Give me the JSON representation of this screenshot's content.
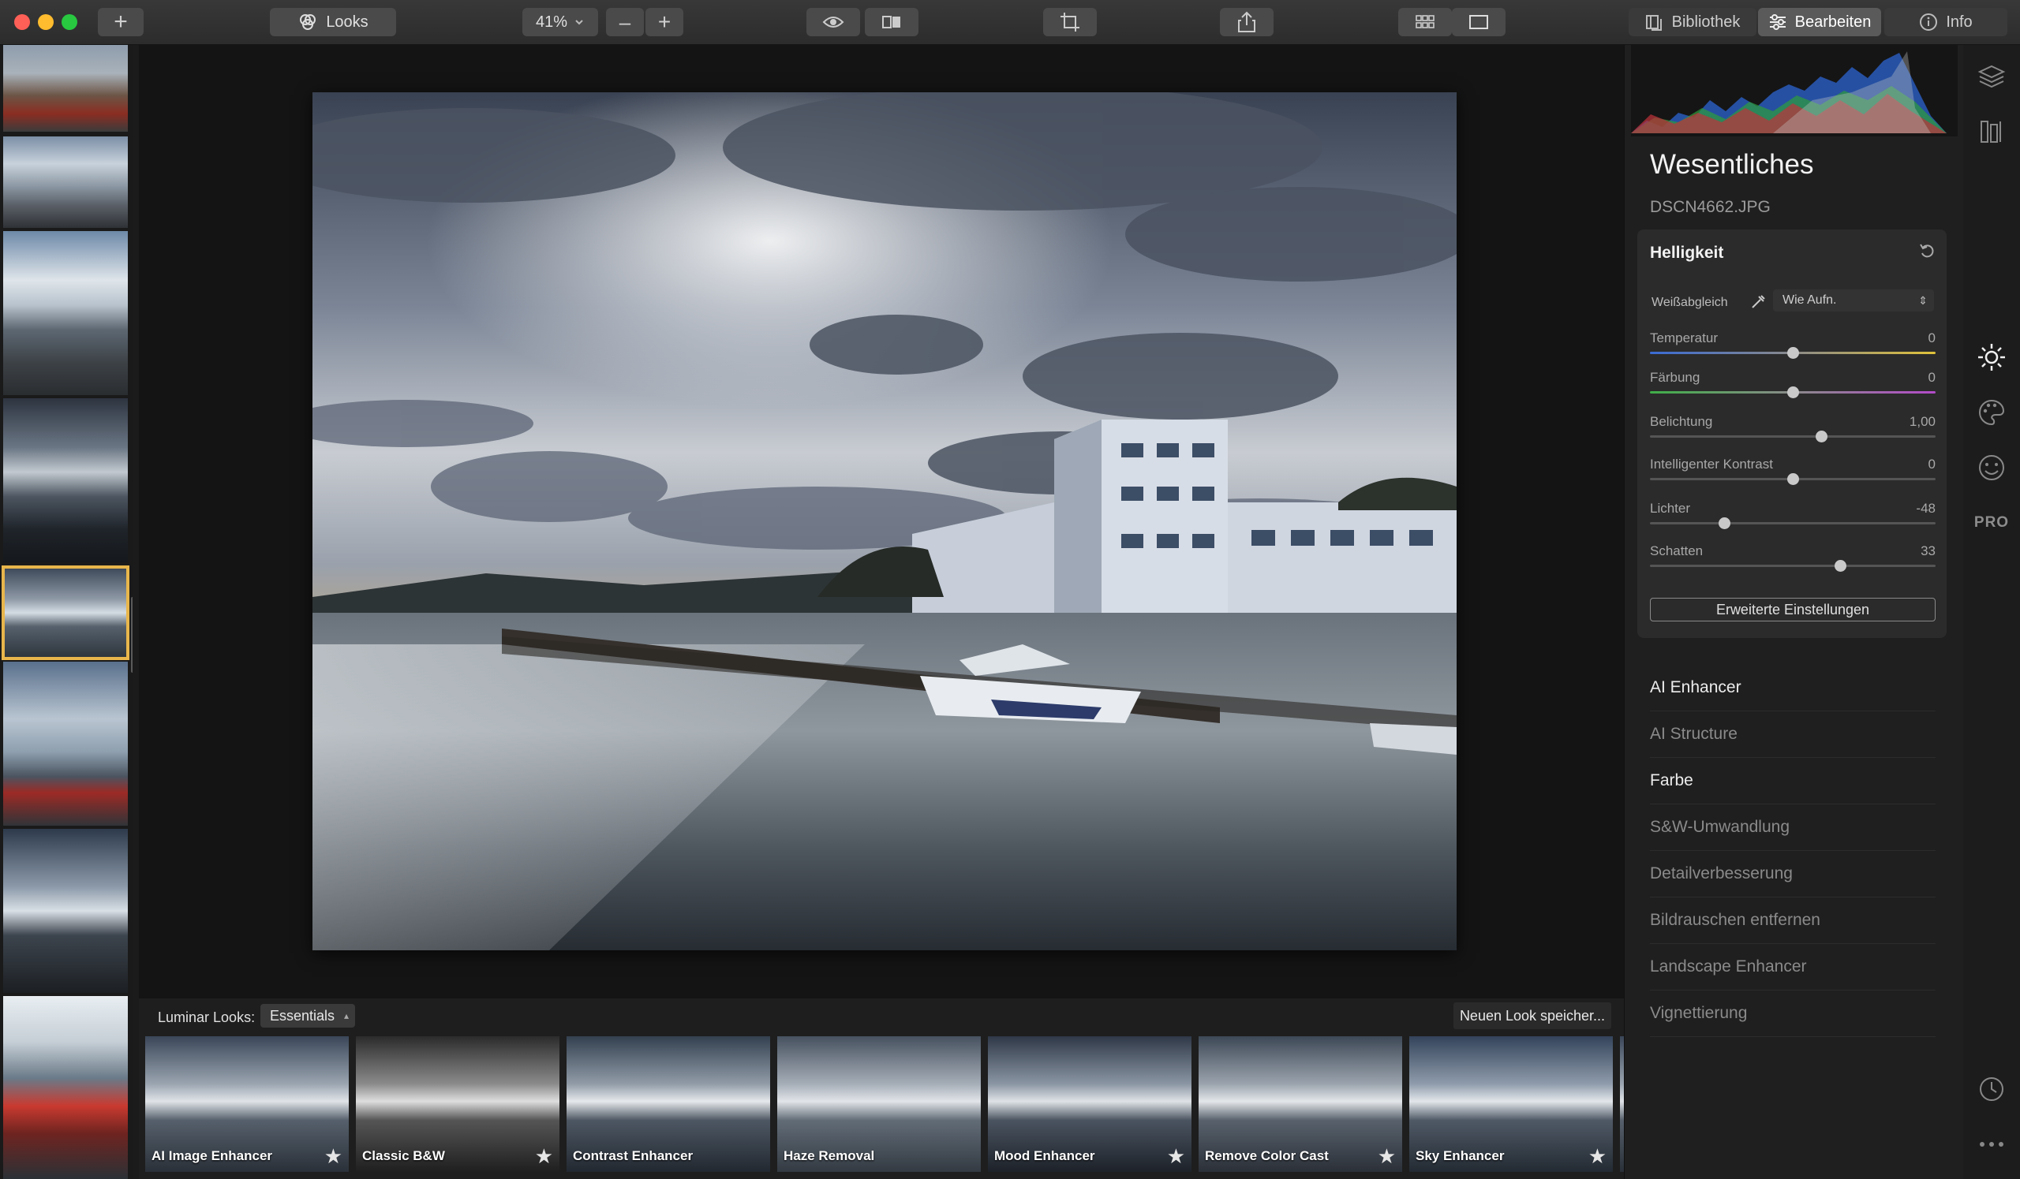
{
  "toolbar": {
    "add_label": "+",
    "looks_label": "Looks",
    "zoom_value": "41%",
    "zoom_out": "–",
    "zoom_in": "+",
    "tabs": [
      {
        "label": "Bibliothek"
      },
      {
        "label": "Bearbeiten"
      },
      {
        "label": "Info"
      }
    ]
  },
  "panel": {
    "title": "Wesentliches",
    "filename": "DSCN4662.JPG",
    "card": {
      "title": "Helligkeit",
      "wb_label": "Weißabgleich",
      "wb_value": "Wie Aufn.",
      "sliders": [
        {
          "label": "Temperatur",
          "value": "0",
          "pos": 0.5
        },
        {
          "label": "Färbung",
          "value": "0",
          "pos": 0.5
        },
        {
          "label": "Belichtung",
          "value": "1,00",
          "pos": 0.6
        },
        {
          "label": "Intelligenter Kontrast",
          "value": "0",
          "pos": 0.5
        },
        {
          "label": "Lichter",
          "value": "-48",
          "pos": 0.26
        },
        {
          "label": "Schatten",
          "value": "33",
          "pos": 0.665
        }
      ],
      "advanced_label": "Erweiterte Einstellungen"
    },
    "sections": [
      {
        "label": "AI Enhancer",
        "active": true
      },
      {
        "label": "AI Structure",
        "active": false
      },
      {
        "label": "Farbe",
        "active": true
      },
      {
        "label": "S&W-Umwandlung",
        "active": false
      },
      {
        "label": "Detailverbesserung",
        "active": false
      },
      {
        "label": "Bildrauschen entfernen",
        "active": false
      },
      {
        "label": "Landscape Enhancer",
        "active": false
      },
      {
        "label": "Vignettierung",
        "active": false
      }
    ]
  },
  "looksbar": {
    "label": "Luminar Looks:",
    "collection": "Essentials",
    "save_label": "Neuen Look speicher...",
    "looks": [
      {
        "name": "AI Image Enhancer",
        "starred": true
      },
      {
        "name": "Classic B&W",
        "starred": true
      },
      {
        "name": "Contrast Enhancer",
        "starred": false
      },
      {
        "name": "Haze Removal",
        "starred": false
      },
      {
        "name": "Mood Enhancer",
        "starred": true
      },
      {
        "name": "Remove Color Cast",
        "starred": true
      },
      {
        "name": "Sky Enhancer",
        "starred": true
      }
    ]
  },
  "rail": {
    "pro_label": "PRO"
  }
}
